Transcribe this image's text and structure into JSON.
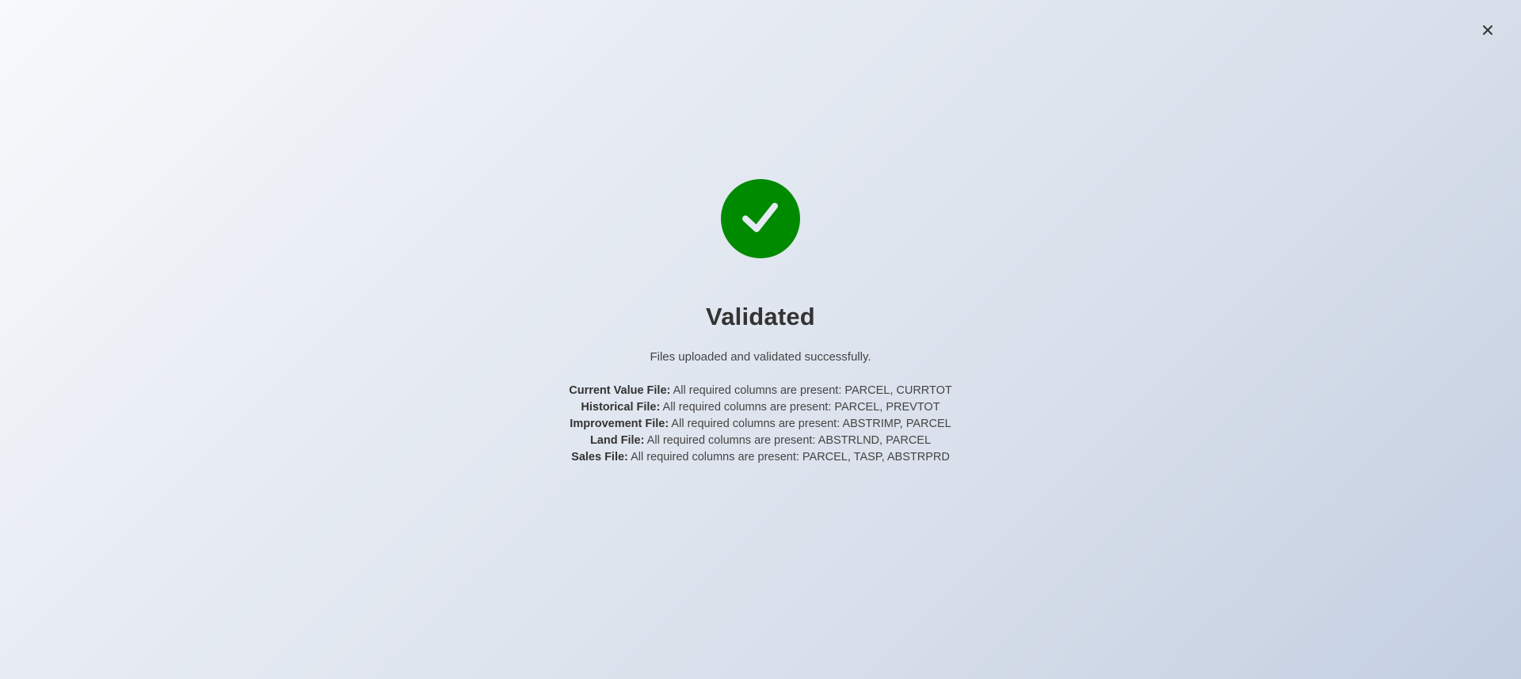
{
  "close": {
    "icon": "close-icon"
  },
  "status": {
    "icon": "checkmark-circle-icon",
    "color": "#008a00",
    "title": "Validated",
    "message": "Files uploaded and validated successfully."
  },
  "files": [
    {
      "label": "Current Value File:",
      "text": "All required columns are present: PARCEL, CURRTOT"
    },
    {
      "label": "Historical File:",
      "text": "All required columns are present: PARCEL, PREVTOT"
    },
    {
      "label": "Improvement File:",
      "text": "All required columns are present: ABSTRIMP, PARCEL"
    },
    {
      "label": "Land File:",
      "text": "All required columns are present: ABSTRLND, PARCEL"
    },
    {
      "label": "Sales File:",
      "text": "All required columns are present: PARCEL, TASP, ABSTRPRD"
    }
  ]
}
